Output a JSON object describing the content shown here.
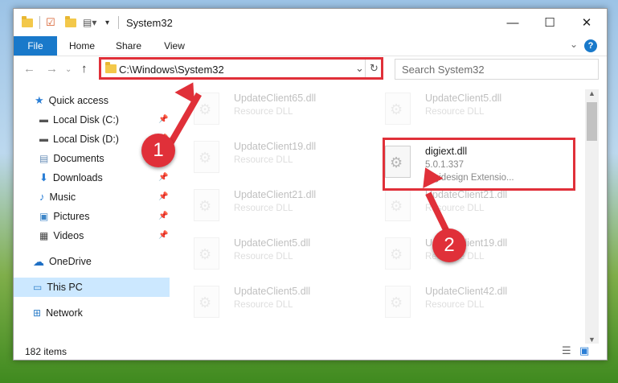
{
  "window": {
    "title": "System32",
    "controls": {
      "minimize": "—",
      "maximize": "☐",
      "close": "✕"
    }
  },
  "ribbon": {
    "tabs": [
      "File",
      "Home",
      "Share",
      "View"
    ],
    "help": "?"
  },
  "nav": {
    "address": "C:\\Windows\\System32",
    "search_placeholder": "Search System32"
  },
  "sidebar": {
    "items": [
      {
        "label": "Quick access",
        "icon": "star-icon",
        "pinned": false
      },
      {
        "label": "Local Disk (C:)",
        "icon": "drive-icon",
        "pinned": true
      },
      {
        "label": "Local Disk (D:)",
        "icon": "drive-icon",
        "pinned": true
      },
      {
        "label": "Documents",
        "icon": "documents-icon",
        "pinned": true
      },
      {
        "label": "Downloads",
        "icon": "download-icon",
        "pinned": true
      },
      {
        "label": "Music",
        "icon": "music-icon",
        "pinned": true
      },
      {
        "label": "Pictures",
        "icon": "pictures-icon",
        "pinned": true
      },
      {
        "label": "Videos",
        "icon": "videos-icon",
        "pinned": true
      },
      {
        "label": "OneDrive",
        "icon": "cloud-icon",
        "pinned": false
      },
      {
        "label": "This PC",
        "icon": "computer-icon",
        "pinned": false,
        "selected": true
      },
      {
        "label": "Network",
        "icon": "network-icon",
        "pinned": false
      }
    ]
  },
  "files": {
    "left": [
      {
        "name": "UpdateClient65.dll",
        "type": "Resource DLL"
      },
      {
        "name": "UpdateClient19.dll",
        "type": "Resource DLL"
      },
      {
        "name": "UpdateClient21.dll",
        "type": "Resource DLL"
      },
      {
        "name": "UpdateClient5.dll",
        "type": "Resource DLL"
      },
      {
        "name": "UpdateClient5.dll",
        "type": "Resource DLL"
      }
    ],
    "right": [
      {
        "name": "UpdateClient5.dll",
        "type": "Resource DLL"
      },
      {
        "name": "digiext.dll",
        "version": "5.0.1.337",
        "type": "Digidesign Extensio..."
      },
      {
        "name": "UpdateClient21.dll",
        "type": "Resource DLL"
      },
      {
        "name": "UpdateClient19.dll",
        "type": "Resource DLL"
      },
      {
        "name": "UpdateClient42.dll",
        "type": "Resource DLL"
      }
    ]
  },
  "status": {
    "count": "182 items"
  },
  "callouts": [
    "1",
    "2"
  ],
  "colors": {
    "accent": "#1979ca",
    "highlight": "#e03039",
    "selection": "#cce8ff"
  }
}
